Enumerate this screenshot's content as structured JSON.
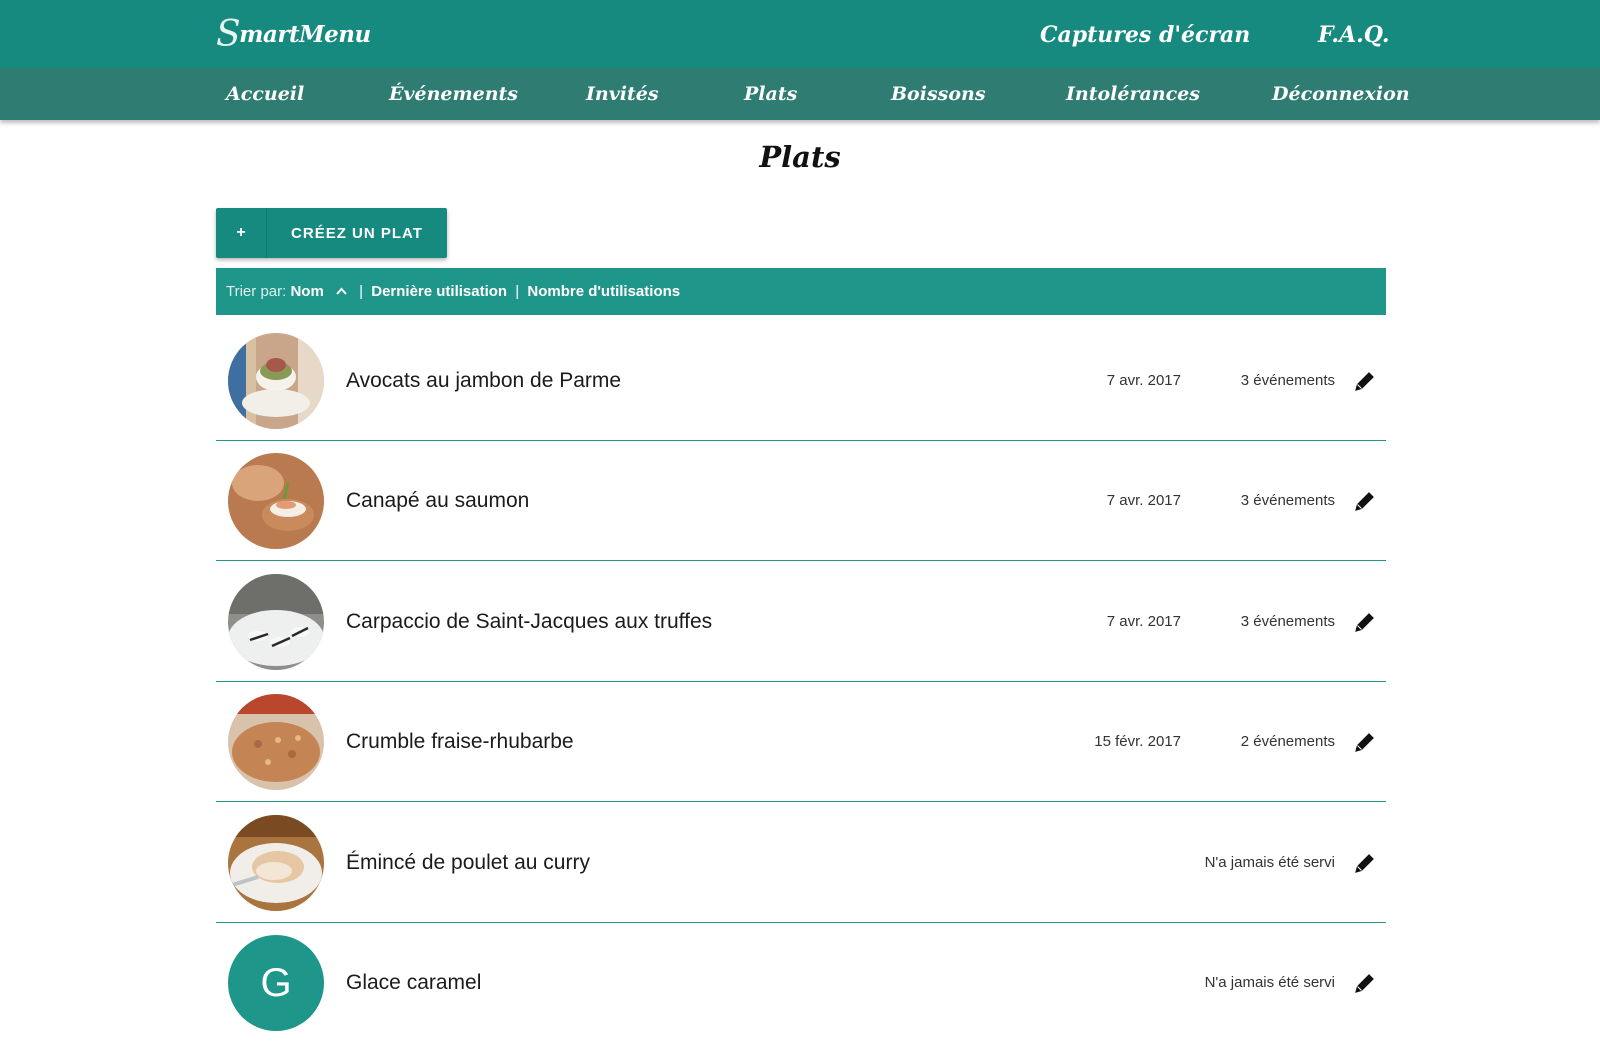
{
  "header": {
    "brand": {
      "first_letter": "S",
      "rest": "martMenu"
    },
    "links": [
      "Captures d'écran",
      "F.A.Q."
    ]
  },
  "nav": {
    "items": [
      "Accueil",
      "Événements",
      "Invités",
      "Plats",
      "Boissons",
      "Intolérances",
      "Déconnexion"
    ]
  },
  "page": {
    "title": "Plats",
    "create_button": {
      "icon": "+",
      "label": "CRÉEZ UN PLAT"
    },
    "sort": {
      "prefix": "Trier par:",
      "options": [
        "Nom",
        "Dernière utilisation",
        "Nombre d'utilisations"
      ],
      "separator": "|",
      "active_icon": "chevron-up-icon"
    }
  },
  "dishes": [
    {
      "name": "Avocats au jambon de Parme",
      "last_used": "7 avr. 2017",
      "usage": "3 événements",
      "image": "photo-avocado-dish"
    },
    {
      "name": "Canapé au saumon",
      "last_used": "7 avr. 2017",
      "usage": "3 événements",
      "image": "photo-salmon-canape"
    },
    {
      "name": "Carpaccio de Saint-Jacques aux truffes",
      "last_used": "7 avr. 2017",
      "usage": "3 événements",
      "image": "photo-scallop-carpaccio"
    },
    {
      "name": "Crumble fraise-rhubarbe",
      "last_used": "15 févr. 2017",
      "usage": "2 événements",
      "image": "photo-crumble"
    },
    {
      "name": "Émincé de poulet au curry",
      "last_used": "",
      "usage": "N'a jamais été servi",
      "image": "photo-chicken-curry"
    },
    {
      "name": "Glace caramel",
      "last_used": "",
      "usage": "N'a jamais été servi",
      "avatar_letter": "G"
    }
  ],
  "colors": {
    "header": "#168a7e",
    "nav": "#2f7c73",
    "accent": "#1f968a"
  }
}
